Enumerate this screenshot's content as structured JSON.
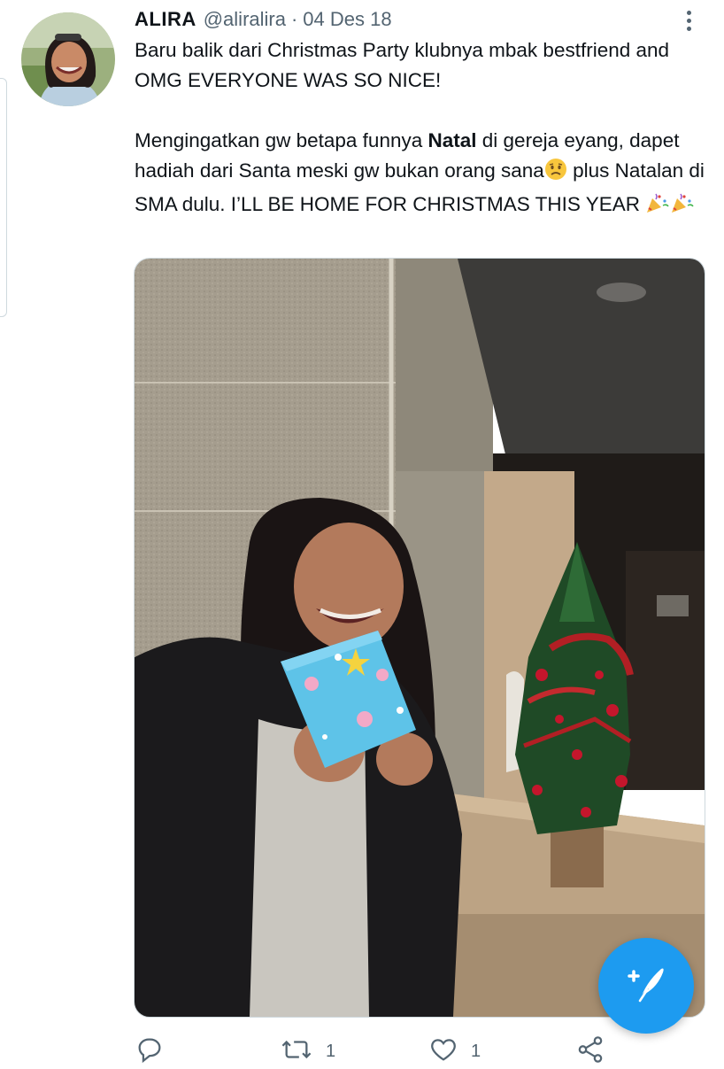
{
  "tweet": {
    "display_name": "ALIRA",
    "handle": "@aliralira",
    "separator": "·",
    "date": "04 Des 18",
    "paragraph1": "Baru balik dari Christmas Party klubnya mbak bestfriend and OMG EVERYONE WAS SO NICE!",
    "paragraph2_pre": "Mengingatkan gw betapa funnya ",
    "paragraph2_bold": "Natal",
    "paragraph2_post": " di gereja eyang, dapet hadiah dari Santa meski gw bukan orang sana",
    "paragraph2_emoji": "sad-face-emoji",
    "paragraph3": " plus Natalan di SMA dulu. I’LL BE HOME FOR CHRISTMAS THIS YEAR ",
    "paragraph3_emoji": "party-popper-emoji",
    "photo": "woman-holding-gift-beside-christmas-tree"
  },
  "actions": {
    "reply": {
      "icon": "reply-icon"
    },
    "retweet": {
      "icon": "retweet-icon",
      "count": "1"
    },
    "like": {
      "icon": "heart-icon",
      "count": "1"
    },
    "share": {
      "icon": "share-icon"
    }
  },
  "compose": {
    "icon": "compose-tweet-icon"
  },
  "colors": {
    "accent": "#1d9bf0",
    "text": "#0f1419",
    "muted": "#536471"
  }
}
